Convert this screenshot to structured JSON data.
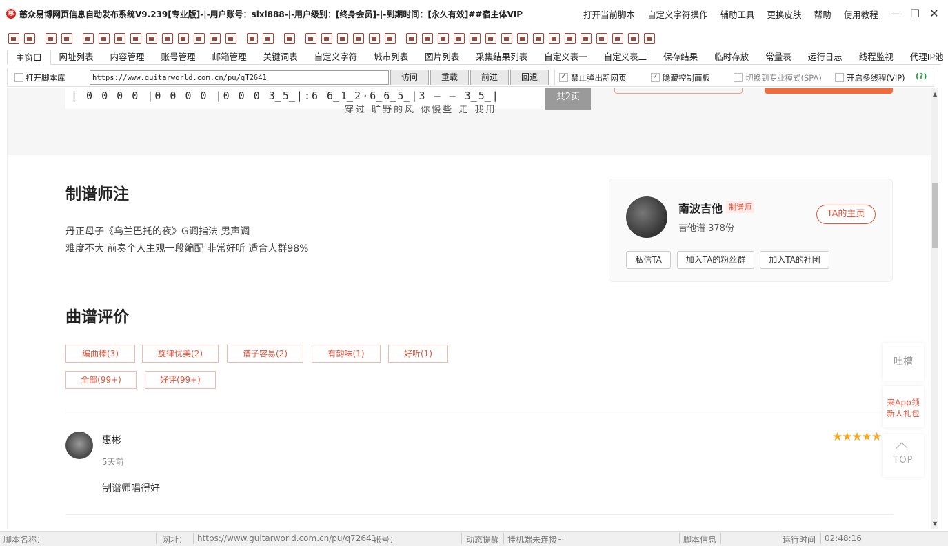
{
  "window": {
    "title": "慈众易博网页信息自动发布系统V9.239[专业版]-|-用户账号：sixi888-|-用户级别：[终身会员]-|-到期时间：[永久有效]##宿主体VIP",
    "menu": [
      "打开当前脚本",
      "自定义字符操作",
      "辅助工具",
      "更换皮肤",
      "帮助",
      "使用教程"
    ],
    "controls": {
      "minimize": "—",
      "maximize": "☐",
      "close": "✕"
    }
  },
  "tabs": [
    "主窗口",
    "网址列表",
    "内容管理",
    "账号管理",
    "邮箱管理",
    "关键词表",
    "自定义字符",
    "城市列表",
    "图片列表",
    "采集结果列表",
    "自定义表一",
    "自定义表二",
    "保存结果",
    "临时存放",
    "常量表",
    "运行日志",
    "线程监视",
    "代理IP池"
  ],
  "addressbar": {
    "open_script_lib": "打开脚本库",
    "url": "https://www.guitarworld.com.cn/pu/qT2641",
    "visit": "访问",
    "reload": "重载",
    "forward": "前进",
    "back": "回退",
    "opt_block_popup": "禁止弹出新网页",
    "opt_hide_panel": "隐藏控制面板",
    "opt_spa": "切换到专业模式(SPA)",
    "opt_multithread": "开启多线程(VIP)",
    "help": "(?)"
  },
  "page": {
    "score_notes": "|   0 0 0 0  |0 0 0 0  |0 0 0 3̲5̲|:6  6̲1̲2·6̲6̲5̲|3  — — 3̲5̲|",
    "score_lyrics": "穿过 旷野的风 你慢些 走   我用",
    "pages_label": "共2页",
    "note_title": "制谱师注",
    "note_line1": "丹正母子《乌兰巴托的夜》G调指法 男声调",
    "note_line2": "难度不大 前奏个人主观一段编配 非常好听 适合人群98%",
    "author": {
      "name": "南波吉他",
      "badge": "制谱师",
      "sub": "吉他谱 378份",
      "home_button": "TA的主页",
      "buttons": [
        "私信TA",
        "加入TA的粉丝群",
        "加入TA的社团"
      ]
    },
    "review_title": "曲谱评价",
    "tags": [
      "编曲棒(3)",
      "旋律优美(2)",
      "谱子容易(2)",
      "有韵味(1)",
      "好听(1)",
      "全部(99+)",
      "好评(99+)"
    ],
    "comment": {
      "name": "惠彬",
      "time": "5天前",
      "text": "制谱师唱得好",
      "stars": "★★★★★"
    },
    "float": {
      "feedback": "吐槽",
      "app_promo": "来App领新人礼包",
      "top": "TOP"
    }
  },
  "status": {
    "script_name_label": "脚本名称：",
    "url_label": "网址：",
    "url_value": "https://www.guitarworld.com.cn/pu/q72641",
    "account_label": "账号：",
    "dynamic_label": "动态提醒",
    "dynamic_value": "挂机端未连接~",
    "script_info_label": "脚本信息",
    "runtime_label": "运行时间",
    "runtime_value": "02:48:16"
  },
  "colors": {
    "accent": "#e5533b",
    "toolbar_icon": "#c0392b",
    "star": "#f5a623"
  }
}
